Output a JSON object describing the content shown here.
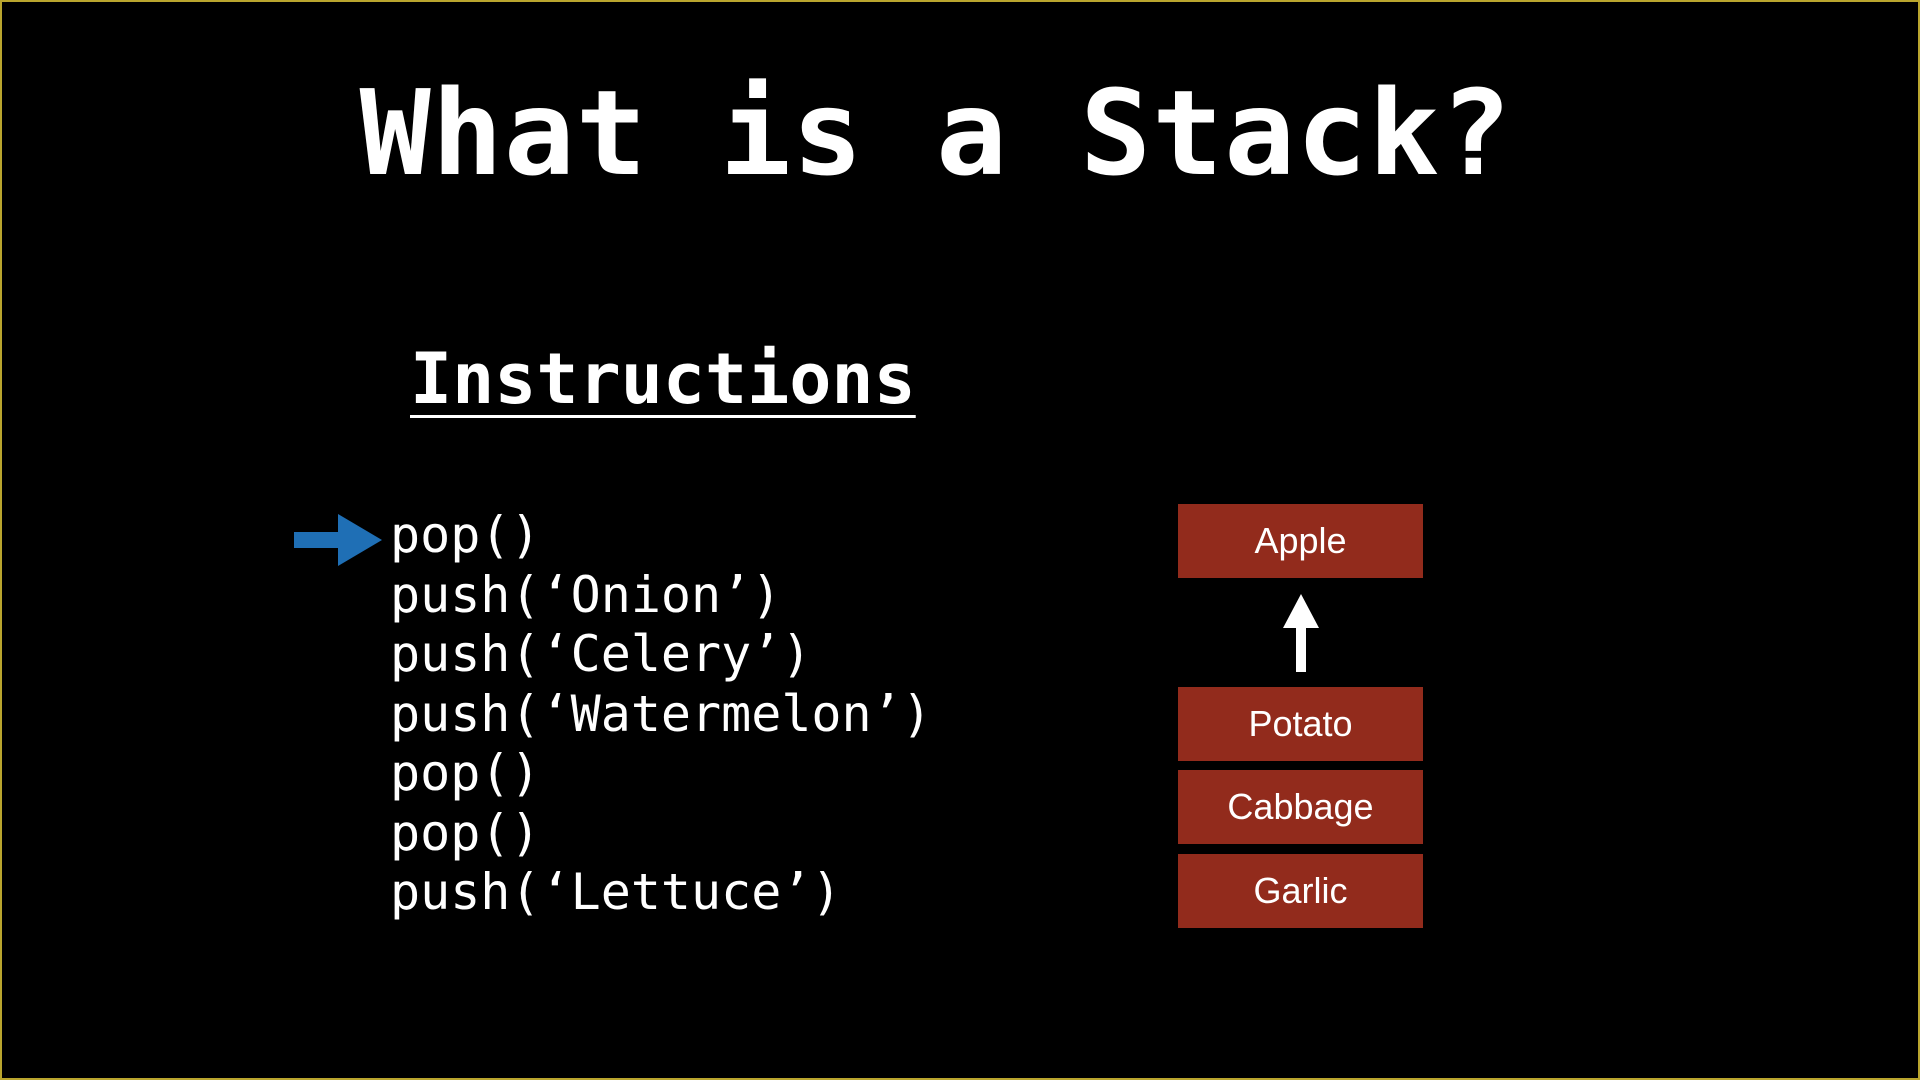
{
  "slide": {
    "title": "What is a Stack?",
    "heading": "Instructions",
    "instructions": [
      "pop()",
      "push(‘Onion’)",
      "push(‘Celery’)",
      "push(‘Watermelon’)",
      "pop()",
      "pop()",
      "push(‘Lettuce’)"
    ],
    "current_instruction": "pop()",
    "popped_item": "Apple",
    "stack_items": [
      "Potato",
      "Cabbage",
      "Garlic"
    ]
  },
  "colors": {
    "background": "#000000",
    "frame": "#b9a52e",
    "stack_box": "#922b1c",
    "pointer_arrow": "#1f6fb5",
    "text": "#ffffff"
  },
  "icons": {
    "pointer": "right-arrow-icon",
    "pop_direction": "up-arrow-icon"
  }
}
